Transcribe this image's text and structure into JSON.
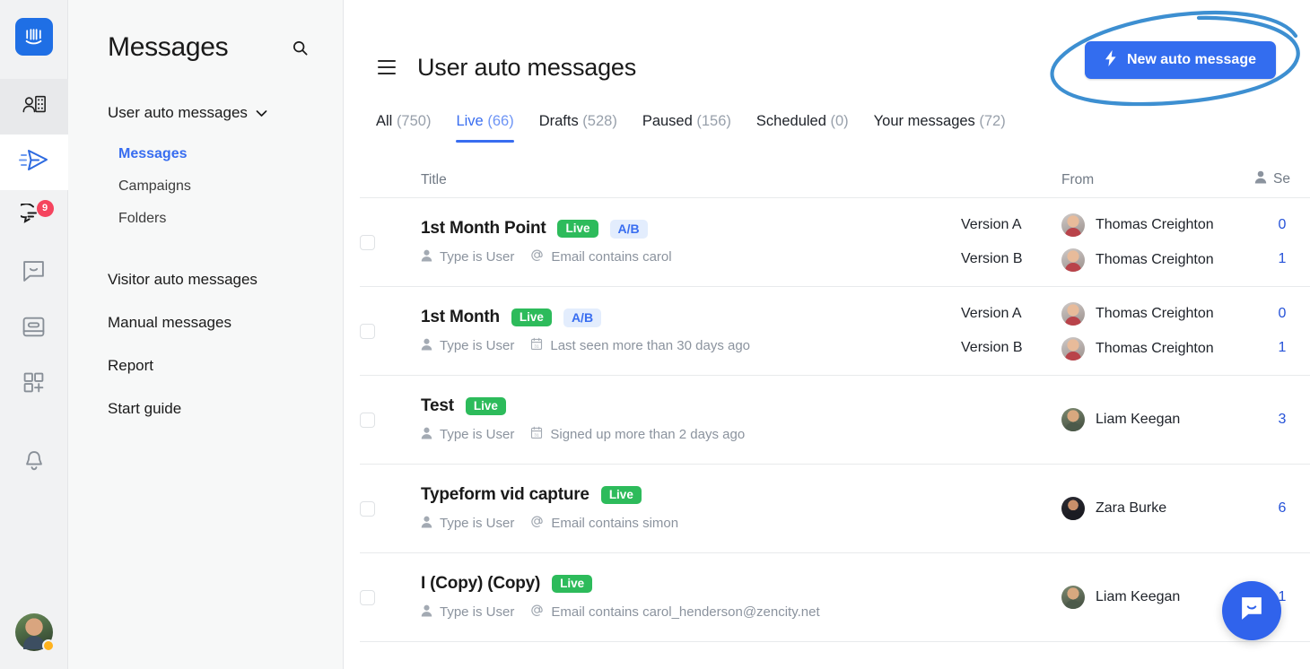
{
  "rail": {
    "logo_icon": "intercom-logo-icon",
    "items": [
      {
        "icon": "contacts-icon",
        "name": "contacts"
      },
      {
        "icon": "paper-plane-icon",
        "name": "outbound-messages"
      },
      {
        "icon": "conversations-icon",
        "name": "conversations",
        "badge": "9"
      },
      {
        "icon": "speech-bubble-icon",
        "name": "messenger"
      },
      {
        "icon": "articles-icon",
        "name": "articles"
      },
      {
        "icon": "apps-grid-plus-icon",
        "name": "apps"
      },
      {
        "icon": "bell-icon",
        "name": "notifications"
      }
    ],
    "avatar_name": "user-avatar",
    "status": "away"
  },
  "sidebar": {
    "title": "Messages",
    "search_icon": "search-icon",
    "group": {
      "label": "User auto messages",
      "chevron": "chevron-down-icon",
      "children": [
        {
          "label": "Messages",
          "active": true
        },
        {
          "label": "Campaigns",
          "active": false
        },
        {
          "label": "Folders",
          "active": false
        }
      ]
    },
    "items": [
      {
        "label": "Visitor auto messages"
      },
      {
        "label": "Manual messages"
      },
      {
        "label": "Report"
      },
      {
        "label": "Start guide"
      }
    ]
  },
  "main": {
    "menu_icon": "hamburger-icon",
    "page_title": "User auto messages",
    "new_button": {
      "label": "New auto message",
      "icon": "lightning-bolt-icon",
      "color": "#336def"
    },
    "tabs": [
      {
        "label": "All",
        "count": "(750)",
        "active": false
      },
      {
        "label": "Live",
        "count": "(66)",
        "active": true
      },
      {
        "label": "Drafts",
        "count": "(528)",
        "active": false
      },
      {
        "label": "Paused",
        "count": "(156)",
        "active": false
      },
      {
        "label": "Scheduled",
        "count": "(0)",
        "active": false
      },
      {
        "label": "Your messages",
        "count": "(72)",
        "active": false
      }
    ],
    "table": {
      "headers": {
        "title": "Title",
        "from": "From",
        "sent": "Se",
        "sent_icon": "person-icon"
      },
      "rows": [
        {
          "title": "1st Month Point",
          "status": "Live",
          "tag": "A/B",
          "meta": [
            {
              "icon": "person-icon",
              "text": "Type is User"
            },
            {
              "icon": "at-sign-icon",
              "text": "Email contains carol"
            }
          ],
          "variants": [
            {
              "version": "Version A",
              "from": "Thomas Creighton",
              "avatar": "thomas",
              "sent": "0"
            },
            {
              "version": "Version B",
              "from": "Thomas Creighton",
              "avatar": "thomas",
              "sent": "1"
            }
          ]
        },
        {
          "title": "1st Month",
          "status": "Live",
          "tag": "A/B",
          "meta": [
            {
              "icon": "person-icon",
              "text": "Type is User"
            },
            {
              "icon": "calendar-icon",
              "text": "Last seen more than 30 days ago"
            }
          ],
          "variants": [
            {
              "version": "Version A",
              "from": "Thomas Creighton",
              "avatar": "thomas",
              "sent": "0"
            },
            {
              "version": "Version B",
              "from": "Thomas Creighton",
              "avatar": "thomas",
              "sent": "1"
            }
          ]
        },
        {
          "title": "Test",
          "status": "Live",
          "tag": "",
          "meta": [
            {
              "icon": "person-icon",
              "text": "Type is User"
            },
            {
              "icon": "calendar-icon",
              "text": "Signed up more than 2 days ago"
            }
          ],
          "variants": [
            {
              "version": "",
              "from": "Liam Keegan",
              "avatar": "liam",
              "sent": "3"
            }
          ]
        },
        {
          "title": "Typeform vid capture",
          "status": "Live",
          "tag": "",
          "meta": [
            {
              "icon": "person-icon",
              "text": "Type is User"
            },
            {
              "icon": "at-sign-icon",
              "text": "Email contains simon"
            }
          ],
          "variants": [
            {
              "version": "",
              "from": "Zara Burke",
              "avatar": "zara",
              "sent": "6"
            }
          ]
        },
        {
          "title": "I (Copy) (Copy)",
          "status": "Live",
          "tag": "",
          "meta": [
            {
              "icon": "person-icon",
              "text": "Type is User"
            },
            {
              "icon": "at-sign-icon",
              "text": "Email contains carol_henderson@zencity.net"
            }
          ],
          "variants": [
            {
              "version": "",
              "from": "Liam Keegan",
              "avatar": "liam",
              "sent": "1"
            }
          ]
        }
      ]
    },
    "launcher_icon": "messenger-launcher-icon",
    "annotation": {
      "shape": "ellipse-highlight",
      "color": "#3d8fd1",
      "target": "new-auto-message-button"
    }
  }
}
